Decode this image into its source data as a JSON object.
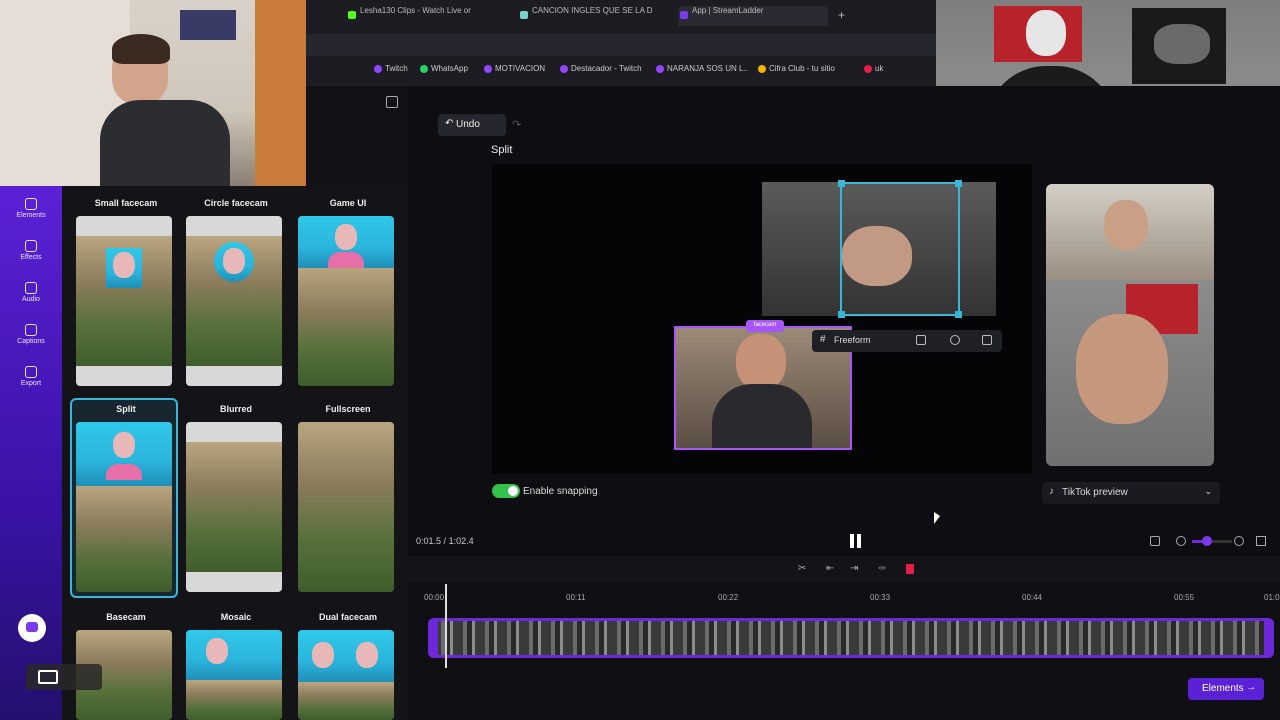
{
  "browser": {
    "tabs": [
      "Lesha130 Clips - Watch Live or",
      "CANCION INGLES QUE SE LA D",
      "App | StreamLadder"
    ],
    "bookmarks": [
      "Twitch",
      "WhatsApp",
      "MOTIVACION",
      "Destacador - Twitch",
      "NARANJA SOS UN L..",
      "Cifra Club - tu sitio",
      "uk"
    ]
  },
  "sidebar": {
    "items": [
      {
        "label": "Elements",
        "icon": "elements-icon"
      },
      {
        "label": "Effects",
        "icon": "effects-icon"
      },
      {
        "label": "Audio",
        "icon": "audio-icon"
      },
      {
        "label": "Captions",
        "icon": "captions-icon"
      },
      {
        "label": "Export",
        "icon": "export-icon"
      }
    ]
  },
  "layouts": [
    {
      "label": "Small facecam"
    },
    {
      "label": "Circle facecam"
    },
    {
      "label": "Game UI"
    },
    {
      "label": "Split"
    },
    {
      "label": "Blurred"
    },
    {
      "label": "Fullscreen"
    },
    {
      "label": "Basecam"
    },
    {
      "label": "Mosaic"
    },
    {
      "label": "Dual facecam"
    }
  ],
  "selected_layout": "Split",
  "editor": {
    "undo_label": "Undo",
    "layout_name": "Split",
    "freeform_label": "Freeform",
    "snapping_label": "Enable snapping",
    "preview_label": "TikTok preview",
    "time_current": "0:01.5",
    "time_total": "1:02.4",
    "camera_tag": "facecam"
  },
  "timeline": {
    "ticks": [
      "00:00",
      "00:11",
      "00:22",
      "00:33",
      "00:44",
      "00:55",
      "01:0"
    ]
  },
  "bottom": {
    "elements_label": "Elements"
  },
  "colors": {
    "accent": "#6d28d9",
    "selection": "#37b8d8",
    "toggle": "#34c24a"
  }
}
